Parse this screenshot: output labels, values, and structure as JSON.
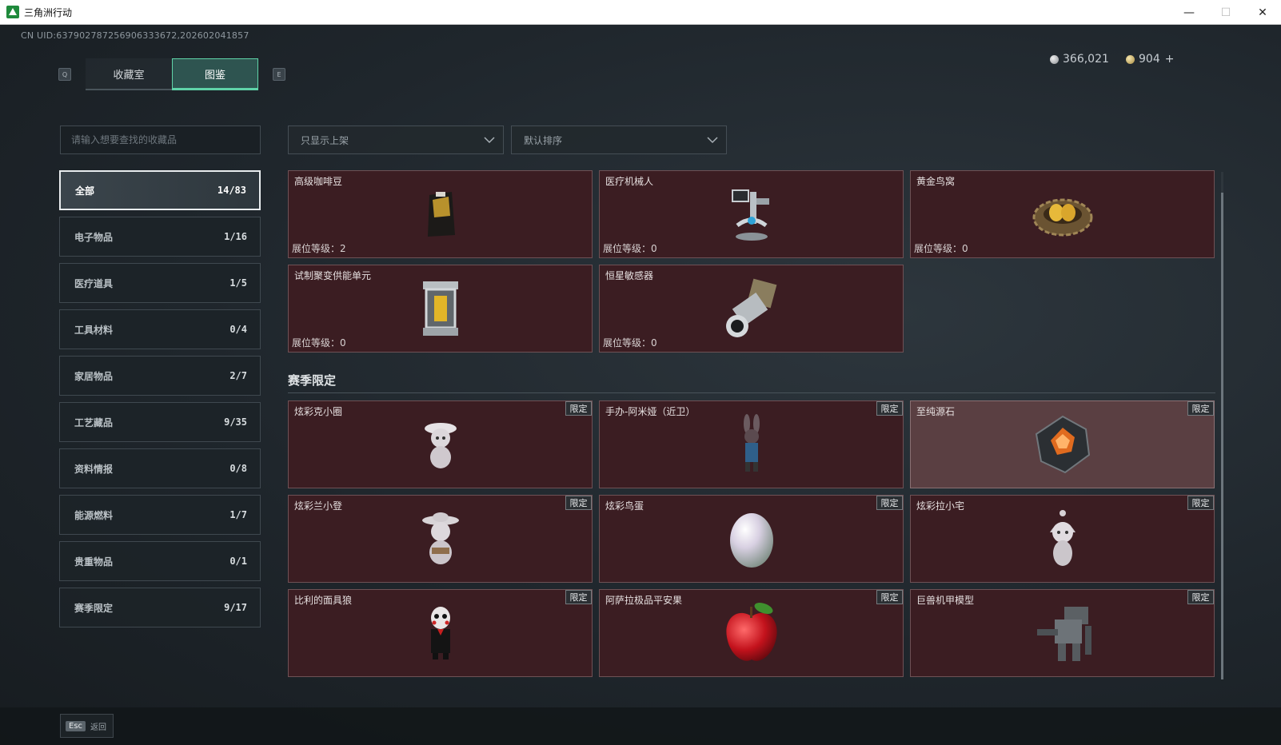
{
  "window": {
    "title": "三角洲行动",
    "minimize": "—",
    "maximize": "☐",
    "close": "✕"
  },
  "uid": "CN UID:637902787256906333672,202602041857",
  "currency": {
    "silver": "366,021",
    "gold": "904",
    "add": "+"
  },
  "keys": {
    "left": "Q",
    "right": "E"
  },
  "tabs": [
    {
      "label": "收藏室",
      "active": false
    },
    {
      "label": "图鉴",
      "active": true
    }
  ],
  "search": {
    "placeholder": "请输入想要查找的收藏品",
    "value": ""
  },
  "filters": {
    "display": "只显示上架",
    "sort": "默认排序"
  },
  "categories": [
    {
      "label": "全部",
      "count": "14/83",
      "active": true
    },
    {
      "label": "电子物品",
      "count": "1/16"
    },
    {
      "label": "医疗道具",
      "count": "1/5"
    },
    {
      "label": "工具材料",
      "count": "0/4"
    },
    {
      "label": "家居物品",
      "count": "2/7"
    },
    {
      "label": "工艺藏品",
      "count": "9/35"
    },
    {
      "label": "资料情报",
      "count": "0/8"
    },
    {
      "label": "能源燃料",
      "count": "1/7"
    },
    {
      "label": "贵重物品",
      "count": "0/1"
    },
    {
      "label": "赛季限定",
      "count": "9/17"
    }
  ],
  "level_label": "展位等级：",
  "items": [
    {
      "name": "高级咖啡豆",
      "level": "2",
      "icon": "coffee-bag-icon"
    },
    {
      "name": "医疗机械人",
      "level": "0",
      "icon": "medical-robot-icon"
    },
    {
      "name": "黄金鸟窝",
      "level": "0",
      "icon": "golden-nest-icon"
    },
    {
      "name": "试制聚变供能单元",
      "level": "0",
      "icon": "fusion-cell-icon"
    },
    {
      "name": "恒星敏感器",
      "level": "0",
      "icon": "star-sensor-icon"
    }
  ],
  "season_section": {
    "title": "赛季限定",
    "badge": "限定"
  },
  "season_items": [
    {
      "name": "炫彩克小圈",
      "icon": "figure-hat-icon"
    },
    {
      "name": "手办-阿米娅（近卫）",
      "icon": "amiya-figure-icon"
    },
    {
      "name": "至纯源石",
      "icon": "originium-icon",
      "highlight": true
    },
    {
      "name": "炫彩兰小登",
      "icon": "sombrero-figure-icon"
    },
    {
      "name": "炫彩鸟蛋",
      "icon": "egg-icon"
    },
    {
      "name": "炫彩拉小宅",
      "icon": "hooded-figure-icon"
    },
    {
      "name": "比利的面具狼",
      "icon": "puppet-icon"
    },
    {
      "name": "阿萨拉极品平安果",
      "icon": "apple-icon"
    },
    {
      "name": "巨兽机甲模型",
      "icon": "mech-model-icon"
    }
  ],
  "footer": {
    "esc_key": "Esc",
    "esc_label": "返回"
  },
  "colors": {
    "card_bg": "#3b1d22",
    "accent": "#5fd3a8",
    "highlight_card": "#5a3f42"
  }
}
